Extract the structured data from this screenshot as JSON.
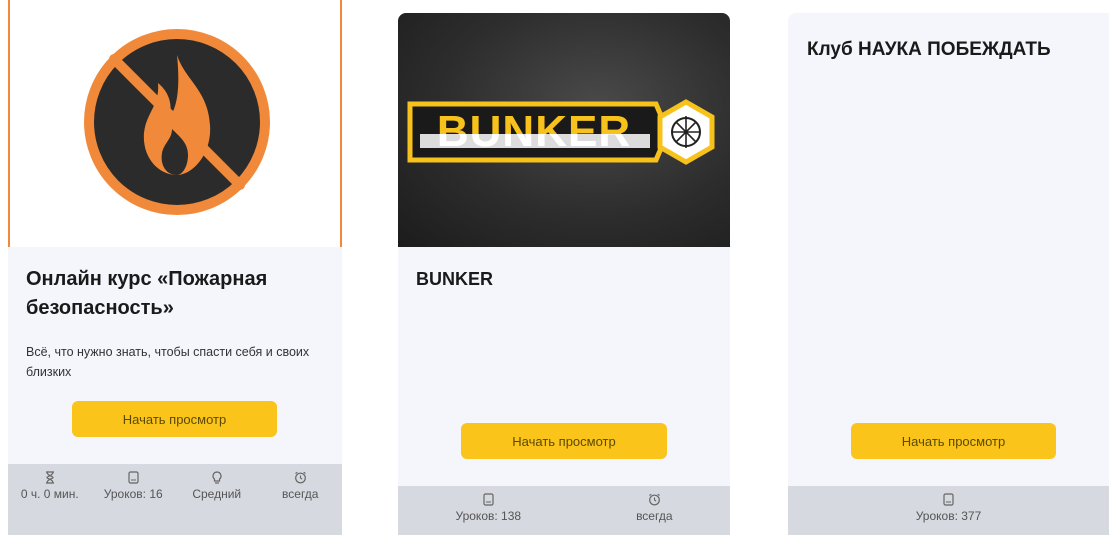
{
  "cards": [
    {
      "title": "Онлайн курс «Пожарная безопасность»",
      "description": "Всё, что нужно знать, чтобы спасти себя и своих близких",
      "button": "Начать просмотр",
      "stats": {
        "duration": "0 ч. 0 мин.",
        "lessons": "Уроков: 16",
        "level": "Средний",
        "access": "всегда"
      },
      "image_icon": "no-fire-icon"
    },
    {
      "title": "BUNKER",
      "logo_text": "BUNKER",
      "button": "Начать просмотр",
      "stats": {
        "lessons": "Уроков: 138",
        "access": "всегда"
      }
    },
    {
      "title": "Клуб НАУКА ПОБЕЖДАТЬ",
      "button": "Начать просмотр",
      "stats": {
        "lessons": "Уроков: 377"
      }
    }
  ],
  "colors": {
    "button": "#fbc41b",
    "card_bg": "#f4f6fc",
    "footer_bg": "#d7d9e0",
    "fire_orange": "#f08a3a",
    "logo_yellow": "#f7c21b"
  }
}
